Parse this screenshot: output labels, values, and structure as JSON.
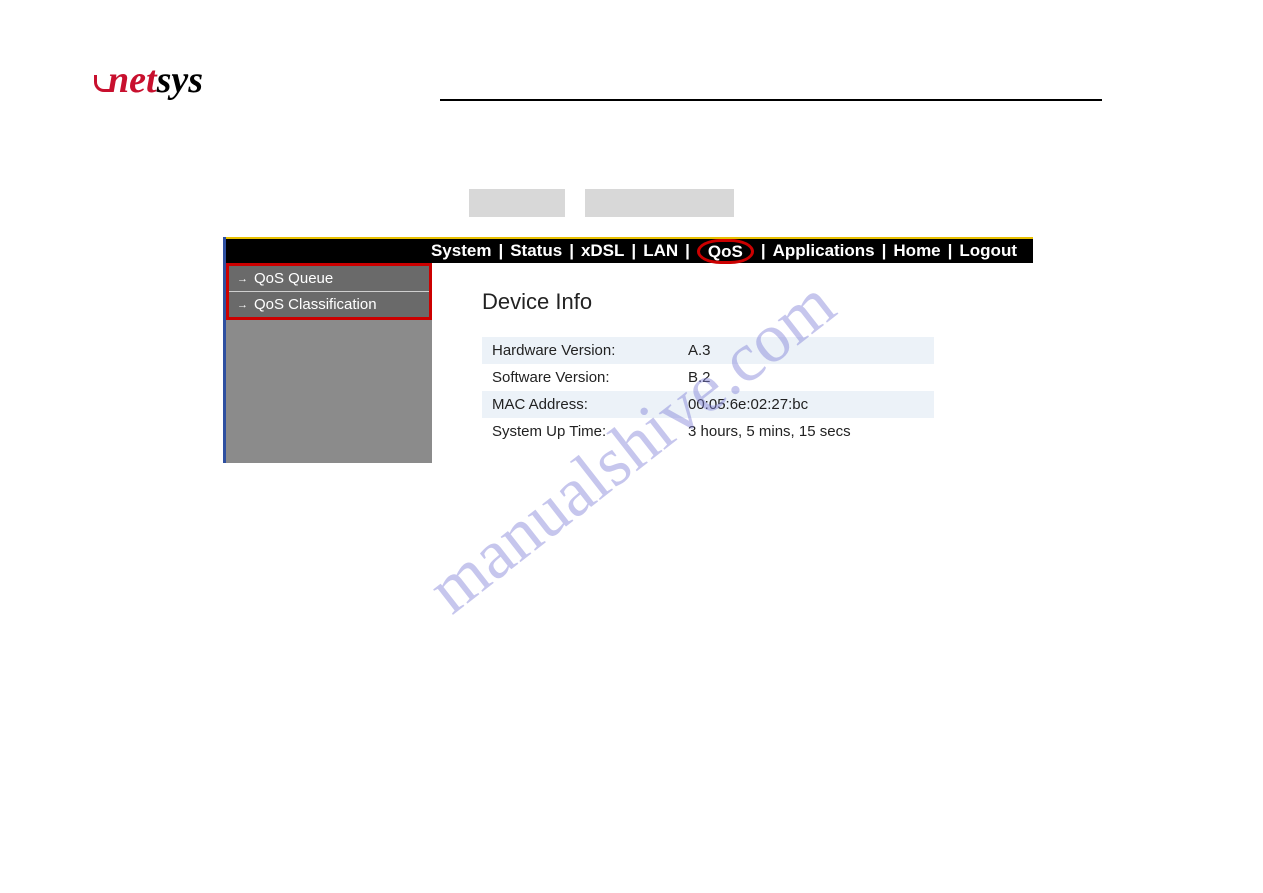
{
  "logo": {
    "net": "net",
    "sys": "sys"
  },
  "nav": {
    "system": "System",
    "status": "Status",
    "xdsl": "xDSL",
    "lan": "LAN",
    "qos": "QoS",
    "applications": "Applications",
    "home": "Home",
    "logout": "Logout",
    "sep": "|"
  },
  "sidebar": {
    "items": [
      {
        "label": "QoS Queue"
      },
      {
        "label": "QoS Classification"
      }
    ]
  },
  "content": {
    "heading": "Device Info",
    "rows": [
      {
        "label": "Hardware Version:",
        "value": "A.3"
      },
      {
        "label": "Software Version:",
        "value": "B.2"
      },
      {
        "label": "MAC Address:",
        "value": "00:05:6e:02:27:bc"
      },
      {
        "label": "System Up Time:",
        "value": "3 hours, 5 mins, 15 secs"
      }
    ]
  },
  "watermark": "manualshive.com"
}
